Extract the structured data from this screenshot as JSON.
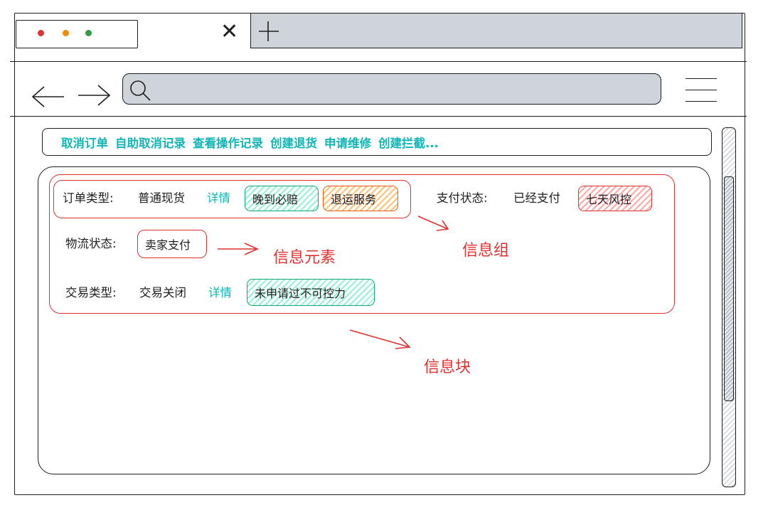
{
  "browser": {
    "tab_dots": [
      "#e03131",
      "#f08c00",
      "#2f9e44"
    ],
    "close_icon": "close-icon",
    "new_tab_icon": "plus-icon",
    "back_icon": "arrow-left-icon",
    "forward_icon": "arrow-right-icon",
    "search_icon": "search-icon",
    "menu_icon": "hamburger-menu-icon"
  },
  "toolbar": {
    "actions": [
      "取消订单",
      "自助取消记录",
      "查看操作记录",
      "创建退货",
      "申请维修",
      "创建拦截..."
    ]
  },
  "order": {
    "order_type_label": "订单类型:",
    "order_type_value": "普通现货",
    "order_type_detail": "详情",
    "order_tags": [
      "晚到必赔",
      "退运服务"
    ],
    "pay_status_label": "支付状态:",
    "pay_status_value": "已经支付",
    "pay_tag": "七天风控",
    "logistics_label": "物流状态:",
    "logistics_value": "卖家支付",
    "trade_type_label": "交易类型:",
    "trade_type_value": "交易关闭",
    "trade_type_detail": "详情",
    "trade_tag": "未申请过不可控力"
  },
  "annotations": {
    "element": "信息元素",
    "group": "信息组",
    "block": "信息块"
  },
  "colors": {
    "accent": "#12b5b5",
    "annotation": "#e03131",
    "chrome_fill": "#ced4da"
  }
}
